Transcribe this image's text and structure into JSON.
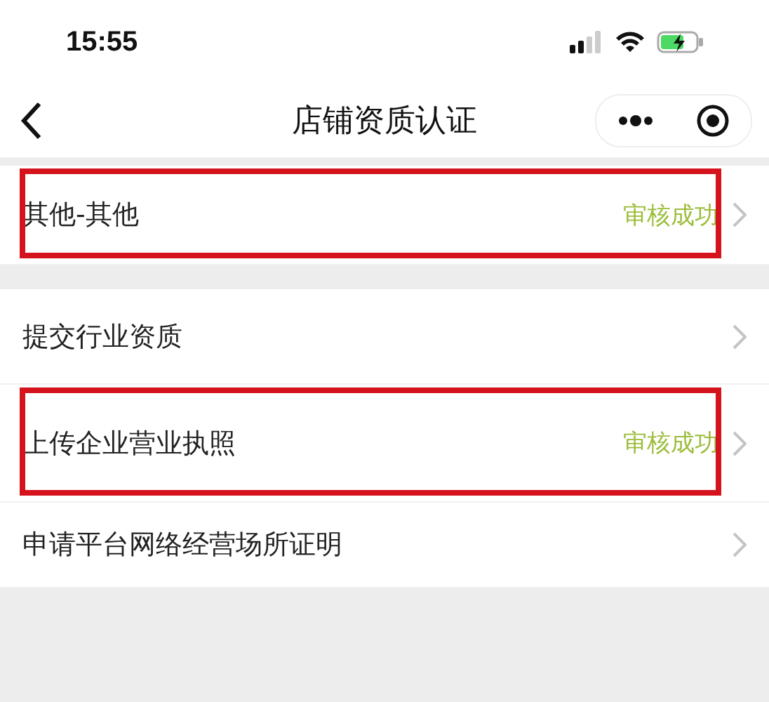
{
  "status_bar": {
    "time": "15:55"
  },
  "nav_bar": {
    "title": "店铺资质认证"
  },
  "groups": [
    {
      "items": [
        {
          "label": "其他-其他",
          "status": "审核成功",
          "highlighted": true
        }
      ]
    },
    {
      "items": [
        {
          "label": "提交行业资质",
          "highlighted": false
        },
        {
          "label": "上传企业营业执照",
          "status": "审核成功",
          "highlighted": true
        },
        {
          "label": "申请平台网络经营场所证明",
          "highlighted": false
        }
      ]
    }
  ]
}
